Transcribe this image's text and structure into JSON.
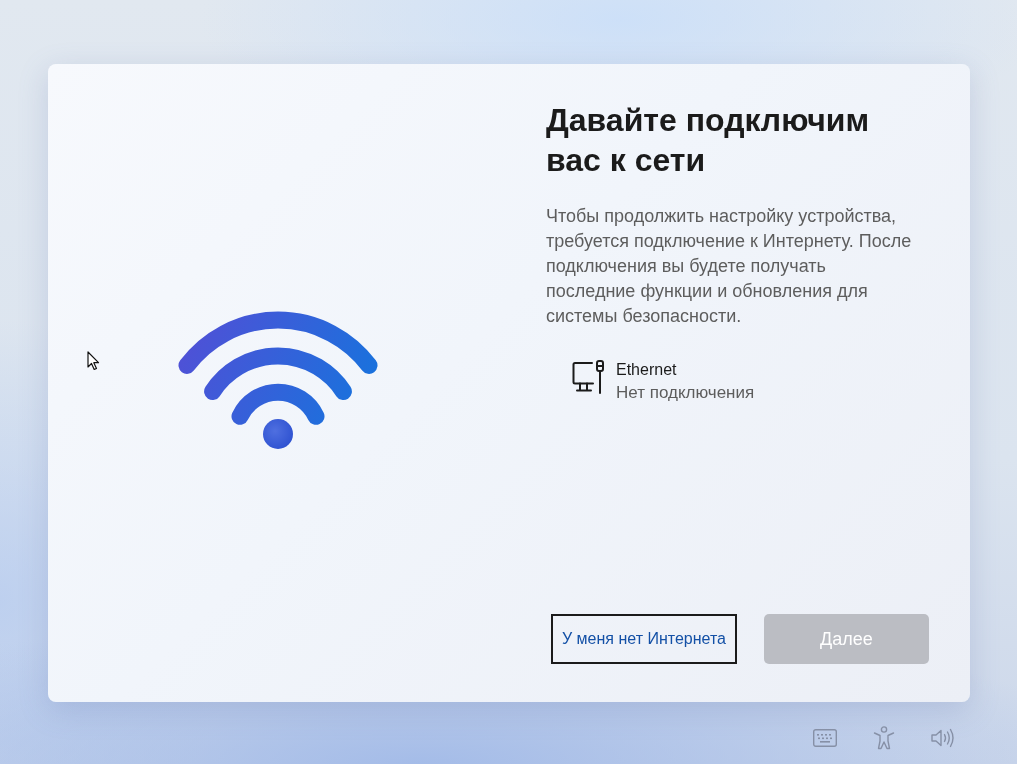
{
  "title": "Давайте подключим вас к сети",
  "description": "Чтобы продолжить настройку устройства, требуется подключение к Интернету. После подключения вы будете получать последние функции и обновления для системы безопасности.",
  "networks": [
    {
      "name": "Ethernet",
      "status": "Нет подключения"
    }
  ],
  "buttons": [
    {
      "label": "У меня нет Интернета",
      "kind": "link",
      "focused": true,
      "disabled": false
    },
    {
      "label": "Далее",
      "kind": "primary",
      "focused": false,
      "disabled": true
    }
  ]
}
